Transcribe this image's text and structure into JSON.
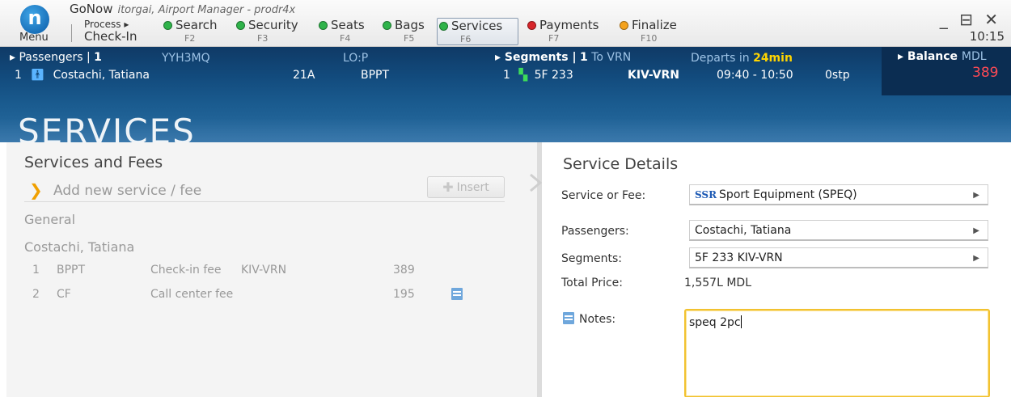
{
  "app": {
    "logo_letter": "n",
    "menu_label": "Menu",
    "title": "GoNow",
    "subtitle": "itorgai, Airport Manager - prodr4x",
    "process_label": "Process ▸",
    "checkin_label": "Check-In",
    "clock": "10:15",
    "window_controls": "_ ⊟ ✕"
  },
  "nav": [
    {
      "label": "Search",
      "key": "F2",
      "status": "green"
    },
    {
      "label": "Security",
      "key": "F3",
      "status": "green"
    },
    {
      "label": "Seats",
      "key": "F4",
      "status": "green"
    },
    {
      "label": "Bags",
      "key": "F5",
      "status": "green"
    },
    {
      "label": "Services",
      "key": "F6",
      "status": "green",
      "active": true
    },
    {
      "label": "Payments",
      "key": "F7",
      "status": "red"
    },
    {
      "label": "Finalize",
      "key": "F10",
      "status": "orange"
    }
  ],
  "colors": {
    "green": "#2fb34a",
    "red": "#d7262b",
    "orange": "#f4a21c",
    "accent": "#ffd400"
  },
  "band": {
    "passengers_label": "▸ Passengers |",
    "passengers_count": "1",
    "pnr": "YYH3MQ",
    "lo_label": "LO:P",
    "pax_index": "1",
    "pax_name": "Costachi, Tatiana",
    "seat": "21A",
    "fee_code": "BPPT",
    "segments_label": "▸ Segments |",
    "segments_count": "1",
    "to_label": "To VRN",
    "departs_prefix": "Departs in",
    "departs_value": "24min",
    "seg_index": "1",
    "flight": "5F 233",
    "route": "KIV-VRN",
    "times": "09:40 - 10:50",
    "stops": "0stp",
    "balance_label": "▸ Balance",
    "balance_currency": "MDL",
    "balance_amount": "389",
    "section_title": "SERVICES"
  },
  "left": {
    "header": "Services and Fees",
    "add_placeholder": "Add new service / fee",
    "insert_label": "Insert",
    "group_general": "General",
    "group_passenger": "Costachi, Tatiana",
    "fees": [
      {
        "num": "1",
        "code": "BPPT",
        "desc": "Check-in fee",
        "route": "KIV-VRN",
        "amount": "389"
      },
      {
        "num": "2",
        "code": "CF",
        "desc": "Call center fee",
        "route": "",
        "amount": "195"
      }
    ]
  },
  "details": {
    "header": "Service Details",
    "service_label": "Service or Fee:",
    "service_tag": "SSR",
    "service_value": "Sport Equipment (SPEQ)",
    "passengers_label": "Passengers:",
    "passengers_value": "Costachi, Tatiana",
    "segments_label": "Segments:",
    "segments_value": "5F  233 KIV-VRN",
    "total_label": "Total Price:",
    "total_value": "1,557L MDL",
    "notes_label": "Notes:",
    "notes_value": "speq 2pc"
  }
}
